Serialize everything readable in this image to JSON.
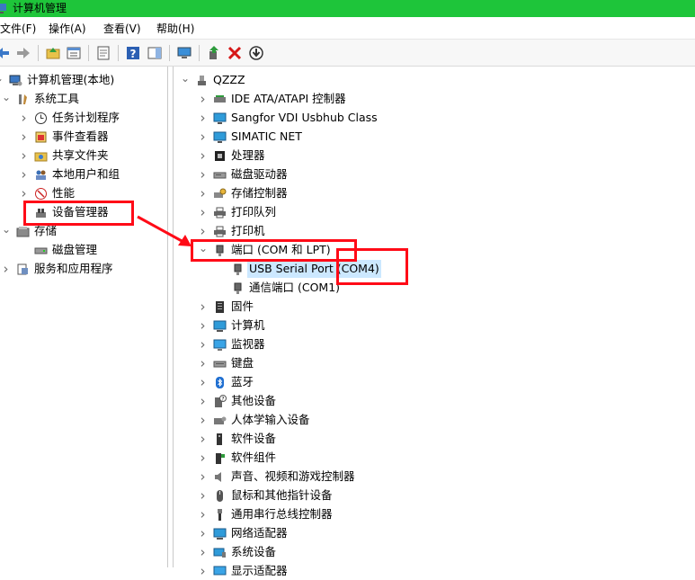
{
  "window": {
    "title": "计算机管理"
  },
  "menu": [
    "文件(F)",
    "操作(A)",
    "查看(V)",
    "帮助(H)"
  ],
  "toolbar_icons": [
    "back-arrow-icon",
    "forward-arrow-icon",
    "up-folder-icon",
    "properties-icon",
    "export-icon",
    "help-icon",
    "action-pane-icon",
    "monitor-icon",
    "update-driver-icon",
    "uninstall-x-icon",
    "download-arrow-icon"
  ],
  "left_tree": [
    {
      "label": "计算机管理(本地)",
      "indent": 0,
      "expanded": true,
      "icon": "computer-mgmt-icon"
    },
    {
      "label": "系统工具",
      "indent": 1,
      "expanded": true,
      "icon": "tools-icon"
    },
    {
      "label": "任务计划程序",
      "indent": 2,
      "expanded": false,
      "icon": "clock-icon"
    },
    {
      "label": "事件查看器",
      "indent": 2,
      "expanded": false,
      "icon": "event-viewer-icon"
    },
    {
      "label": "共享文件夹",
      "indent": 2,
      "expanded": false,
      "icon": "shared-folder-icon"
    },
    {
      "label": "本地用户和组",
      "indent": 2,
      "expanded": false,
      "icon": "users-icon"
    },
    {
      "label": "性能",
      "indent": 2,
      "expanded": false,
      "icon": "performance-icon"
    },
    {
      "label": "设备管理器",
      "indent": 2,
      "expanded": null,
      "icon": "device-manager-icon"
    },
    {
      "label": "存储",
      "indent": 1,
      "expanded": true,
      "icon": "storage-icon"
    },
    {
      "label": "磁盘管理",
      "indent": 2,
      "expanded": null,
      "icon": "disk-icon"
    },
    {
      "label": "服务和应用程序",
      "indent": 1,
      "expanded": false,
      "icon": "services-icon"
    }
  ],
  "device_tree": {
    "root": "QZZZ",
    "items": [
      {
        "label": "IDE ATA/ATAPI 控制器",
        "icon": "ide-controller-icon",
        "expanded": false,
        "level": 1
      },
      {
        "label": "Sangfor VDI Usbhub Class",
        "icon": "network-monitor-icon",
        "expanded": false,
        "level": 1
      },
      {
        "label": "SIMATIC NET",
        "icon": "network-monitor-icon",
        "expanded": false,
        "level": 1
      },
      {
        "label": "处理器",
        "icon": "cpu-icon",
        "expanded": false,
        "level": 1
      },
      {
        "label": "磁盘驱动器",
        "icon": "disk-drive-icon",
        "expanded": false,
        "level": 1
      },
      {
        "label": "存储控制器",
        "icon": "storage-controller-icon",
        "expanded": false,
        "level": 1
      },
      {
        "label": "打印队列",
        "icon": "printer-icon",
        "expanded": false,
        "level": 1
      },
      {
        "label": "打印机",
        "icon": "printer-icon",
        "expanded": false,
        "level": 1
      },
      {
        "label": "端口 (COM 和 LPT)",
        "icon": "port-icon",
        "expanded": true,
        "level": 1
      },
      {
        "label": "USB Serial Port (COM4)",
        "icon": "port-icon",
        "expanded": null,
        "level": 2,
        "selected": true
      },
      {
        "label": "通信端口 (COM1)",
        "icon": "port-icon",
        "expanded": null,
        "level": 2
      },
      {
        "label": "固件",
        "icon": "firmware-icon",
        "expanded": false,
        "level": 1
      },
      {
        "label": "计算机",
        "icon": "computer-icon",
        "expanded": false,
        "level": 1
      },
      {
        "label": "监视器",
        "icon": "monitor-icon",
        "expanded": false,
        "level": 1
      },
      {
        "label": "键盘",
        "icon": "keyboard-icon",
        "expanded": false,
        "level": 1
      },
      {
        "label": "蓝牙",
        "icon": "bluetooth-icon",
        "expanded": false,
        "level": 1
      },
      {
        "label": "其他设备",
        "icon": "unknown-device-icon",
        "expanded": false,
        "level": 1
      },
      {
        "label": "人体学输入设备",
        "icon": "hid-icon",
        "expanded": false,
        "level": 1
      },
      {
        "label": "软件设备",
        "icon": "software-device-icon",
        "expanded": false,
        "level": 1
      },
      {
        "label": "软件组件",
        "icon": "software-component-icon",
        "expanded": false,
        "level": 1
      },
      {
        "label": "声音、视频和游戏控制器",
        "icon": "speaker-icon",
        "expanded": false,
        "level": 1
      },
      {
        "label": "鼠标和其他指针设备",
        "icon": "mouse-icon",
        "expanded": false,
        "level": 1
      },
      {
        "label": "通用串行总线控制器",
        "icon": "usb-icon",
        "expanded": false,
        "level": 1
      },
      {
        "label": "网络适配器",
        "icon": "network-adapter-icon",
        "expanded": false,
        "level": 1
      },
      {
        "label": "系统设备",
        "icon": "system-device-icon",
        "expanded": false,
        "level": 1
      },
      {
        "label": "显示适配器",
        "icon": "display-adapter-icon",
        "expanded": false,
        "level": 1
      }
    ]
  },
  "colors": {
    "titlebar": "#1ec53a",
    "highlight": "#ff0b17",
    "selection": "#cce8ff"
  }
}
